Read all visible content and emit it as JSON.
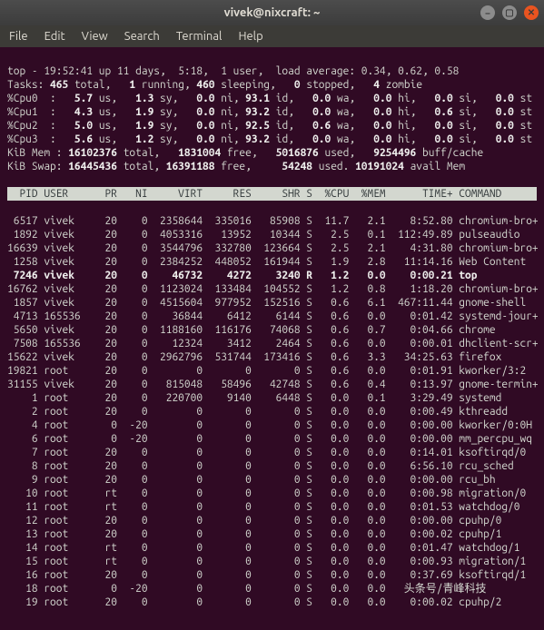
{
  "window": {
    "title": "vivek@nixcraft: ~"
  },
  "menu": [
    "File",
    "Edit",
    "View",
    "Search",
    "Terminal",
    "Help"
  ],
  "summary": {
    "top_line": {
      "time": "19:52:41",
      "up": "up 11 days,  5:18",
      "users": "1 user",
      "load_label": "load average:",
      "load": "0.34, 0.62, 0.58"
    },
    "tasks": {
      "label": "Tasks:",
      "total": "465",
      "running": "1",
      "sleeping": "460",
      "stopped": "0",
      "zombie": "4"
    },
    "cpus": [
      {
        "name": "%Cpu0",
        "us": "5.7",
        "sy": "1.3",
        "ni": "0.0",
        "id": "93.1",
        "wa": "0.0",
        "hi": "0.0",
        "si": "0.0",
        "st": "0.0"
      },
      {
        "name": "%Cpu1",
        "us": "4.3",
        "sy": "1.9",
        "ni": "0.0",
        "id": "93.2",
        "wa": "0.0",
        "hi": "0.0",
        "si": "0.6",
        "st": "0.0"
      },
      {
        "name": "%Cpu2",
        "us": "5.0",
        "sy": "1.9",
        "ni": "0.0",
        "id": "92.5",
        "wa": "0.6",
        "hi": "0.0",
        "si": "0.0",
        "st": "0.0"
      },
      {
        "name": "%Cpu3",
        "us": "5.6",
        "sy": "1.2",
        "ni": "0.0",
        "id": "93.2",
        "wa": "0.0",
        "hi": "0.0",
        "si": "0.0",
        "st": "0.0"
      }
    ],
    "mem": {
      "label": "KiB Mem :",
      "total": "16102376",
      "free": "1831004",
      "used": "5016876",
      "buff": "9254496"
    },
    "swap": {
      "label": "KiB Swap:",
      "total": "16445436",
      "free": "16391188",
      "used": "54248",
      "avail": "10191024"
    }
  },
  "columns": [
    "PID",
    "USER",
    "PR",
    "NI",
    "VIRT",
    "RES",
    "SHR",
    "S",
    "%CPU",
    "%MEM",
    "TIME+",
    "COMMAND"
  ],
  "processes": [
    {
      "pid": "6517",
      "user": "vivek",
      "pr": "20",
      "ni": "0",
      "virt": "2358644",
      "res": "335016",
      "shr": "85908",
      "s": "S",
      "cpu": "11.7",
      "mem": "2.1",
      "time": "8:52.80",
      "cmd": "chromium-bro+"
    },
    {
      "pid": "1892",
      "user": "vivek",
      "pr": "20",
      "ni": "0",
      "virt": "4053316",
      "res": "13952",
      "shr": "10344",
      "s": "S",
      "cpu": "2.5",
      "mem": "0.1",
      "time": "112:49.89",
      "cmd": "pulseaudio"
    },
    {
      "pid": "16639",
      "user": "vivek",
      "pr": "20",
      "ni": "0",
      "virt": "3544796",
      "res": "332780",
      "shr": "123664",
      "s": "S",
      "cpu": "2.5",
      "mem": "2.1",
      "time": "4:31.80",
      "cmd": "chromium-bro+"
    },
    {
      "pid": "1258",
      "user": "vivek",
      "pr": "20",
      "ni": "0",
      "virt": "2384252",
      "res": "448052",
      "shr": "161944",
      "s": "S",
      "cpu": "1.9",
      "mem": "2.8",
      "time": "11:14.16",
      "cmd": "Web Content"
    },
    {
      "pid": "7246",
      "user": "vivek",
      "pr": "20",
      "ni": "0",
      "virt": "46732",
      "res": "4272",
      "shr": "3240",
      "s": "R",
      "cpu": "1.2",
      "mem": "0.0",
      "time": "0:00.21",
      "cmd": "top",
      "highlight": true
    },
    {
      "pid": "16762",
      "user": "vivek",
      "pr": "20",
      "ni": "0",
      "virt": "1123024",
      "res": "133484",
      "shr": "104552",
      "s": "S",
      "cpu": "1.2",
      "mem": "0.8",
      "time": "1:18.20",
      "cmd": "chromium-bro+"
    },
    {
      "pid": "1857",
      "user": "vivek",
      "pr": "20",
      "ni": "0",
      "virt": "4515604",
      "res": "977952",
      "shr": "152516",
      "s": "S",
      "cpu": "0.6",
      "mem": "6.1",
      "time": "467:11.44",
      "cmd": "gnome-shell"
    },
    {
      "pid": "4713",
      "user": "165536",
      "pr": "20",
      "ni": "0",
      "virt": "36844",
      "res": "6412",
      "shr": "6144",
      "s": "S",
      "cpu": "0.6",
      "mem": "0.0",
      "time": "0:01.42",
      "cmd": "systemd-jour+"
    },
    {
      "pid": "5650",
      "user": "vivek",
      "pr": "20",
      "ni": "0",
      "virt": "1188160",
      "res": "116176",
      "shr": "74068",
      "s": "S",
      "cpu": "0.6",
      "mem": "0.7",
      "time": "0:04.66",
      "cmd": "chrome"
    },
    {
      "pid": "7508",
      "user": "165536",
      "pr": "20",
      "ni": "0",
      "virt": "12324",
      "res": "3412",
      "shr": "2464",
      "s": "S",
      "cpu": "0.6",
      "mem": "0.0",
      "time": "0:00.01",
      "cmd": "dhclient-scr+"
    },
    {
      "pid": "15622",
      "user": "vivek",
      "pr": "20",
      "ni": "0",
      "virt": "2962796",
      "res": "531744",
      "shr": "173416",
      "s": "S",
      "cpu": "0.6",
      "mem": "3.3",
      "time": "34:25.63",
      "cmd": "firefox"
    },
    {
      "pid": "19821",
      "user": "root",
      "pr": "20",
      "ni": "0",
      "virt": "0",
      "res": "0",
      "shr": "0",
      "s": "S",
      "cpu": "0.6",
      "mem": "0.0",
      "time": "0:01.91",
      "cmd": "kworker/3:2"
    },
    {
      "pid": "31155",
      "user": "vivek",
      "pr": "20",
      "ni": "0",
      "virt": "815048",
      "res": "58496",
      "shr": "42748",
      "s": "S",
      "cpu": "0.6",
      "mem": "0.4",
      "time": "0:13.97",
      "cmd": "gnome-termin+"
    },
    {
      "pid": "1",
      "user": "root",
      "pr": "20",
      "ni": "0",
      "virt": "220700",
      "res": "9140",
      "shr": "6448",
      "s": "S",
      "cpu": "0.0",
      "mem": "0.1",
      "time": "3:29.49",
      "cmd": "systemd"
    },
    {
      "pid": "2",
      "user": "root",
      "pr": "20",
      "ni": "0",
      "virt": "0",
      "res": "0",
      "shr": "0",
      "s": "S",
      "cpu": "0.0",
      "mem": "0.0",
      "time": "0:00.49",
      "cmd": "kthreadd"
    },
    {
      "pid": "4",
      "user": "root",
      "pr": "0",
      "ni": "-20",
      "virt": "0",
      "res": "0",
      "shr": "0",
      "s": "S",
      "cpu": "0.0",
      "mem": "0.0",
      "time": "0:00.00",
      "cmd": "kworker/0:0H"
    },
    {
      "pid": "6",
      "user": "root",
      "pr": "0",
      "ni": "-20",
      "virt": "0",
      "res": "0",
      "shr": "0",
      "s": "S",
      "cpu": "0.0",
      "mem": "0.0",
      "time": "0:00.00",
      "cmd": "mm_percpu_wq"
    },
    {
      "pid": "7",
      "user": "root",
      "pr": "20",
      "ni": "0",
      "virt": "0",
      "res": "0",
      "shr": "0",
      "s": "S",
      "cpu": "0.0",
      "mem": "0.0",
      "time": "0:14.01",
      "cmd": "ksoftirqd/0"
    },
    {
      "pid": "8",
      "user": "root",
      "pr": "20",
      "ni": "0",
      "virt": "0",
      "res": "0",
      "shr": "0",
      "s": "S",
      "cpu": "0.0",
      "mem": "0.0",
      "time": "6:56.10",
      "cmd": "rcu_sched"
    },
    {
      "pid": "9",
      "user": "root",
      "pr": "20",
      "ni": "0",
      "virt": "0",
      "res": "0",
      "shr": "0",
      "s": "S",
      "cpu": "0.0",
      "mem": "0.0",
      "time": "0:00.00",
      "cmd": "rcu_bh"
    },
    {
      "pid": "10",
      "user": "root",
      "pr": "rt",
      "ni": "0",
      "virt": "0",
      "res": "0",
      "shr": "0",
      "s": "S",
      "cpu": "0.0",
      "mem": "0.0",
      "time": "0:00.98",
      "cmd": "migration/0"
    },
    {
      "pid": "11",
      "user": "root",
      "pr": "rt",
      "ni": "0",
      "virt": "0",
      "res": "0",
      "shr": "0",
      "s": "S",
      "cpu": "0.0",
      "mem": "0.0",
      "time": "0:01.53",
      "cmd": "watchdog/0"
    },
    {
      "pid": "12",
      "user": "root",
      "pr": "20",
      "ni": "0",
      "virt": "0",
      "res": "0",
      "shr": "0",
      "s": "S",
      "cpu": "0.0",
      "mem": "0.0",
      "time": "0:00.00",
      "cmd": "cpuhp/0"
    },
    {
      "pid": "13",
      "user": "root",
      "pr": "20",
      "ni": "0",
      "virt": "0",
      "res": "0",
      "shr": "0",
      "s": "S",
      "cpu": "0.0",
      "mem": "0.0",
      "time": "0:00.02",
      "cmd": "cpuhp/1"
    },
    {
      "pid": "14",
      "user": "root",
      "pr": "rt",
      "ni": "0",
      "virt": "0",
      "res": "0",
      "shr": "0",
      "s": "S",
      "cpu": "0.0",
      "mem": "0.0",
      "time": "0:01.47",
      "cmd": "watchdog/1"
    },
    {
      "pid": "15",
      "user": "root",
      "pr": "rt",
      "ni": "0",
      "virt": "0",
      "res": "0",
      "shr": "0",
      "s": "S",
      "cpu": "0.0",
      "mem": "0.0",
      "time": "0:00.93",
      "cmd": "migration/1"
    },
    {
      "pid": "16",
      "user": "root",
      "pr": "20",
      "ni": "0",
      "virt": "0",
      "res": "0",
      "shr": "0",
      "s": "S",
      "cpu": "0.0",
      "mem": "0.0",
      "time": "0:37.69",
      "cmd": "ksoftirqd/1"
    },
    {
      "pid": "18",
      "user": "root",
      "pr": "0",
      "ni": "-20",
      "virt": "0",
      "res": "0",
      "shr": "0",
      "s": "S",
      "cpu": "0.0",
      "mem": "0.0",
      "time": "头条号/青峰科技",
      "cmd": ""
    },
    {
      "pid": "19",
      "user": "root",
      "pr": "20",
      "ni": "0",
      "virt": "0",
      "res": "0",
      "shr": "0",
      "s": "S",
      "cpu": "0.0",
      "mem": "0.0",
      "time": "0:00.02",
      "cmd": "cpuhp/2"
    }
  ]
}
